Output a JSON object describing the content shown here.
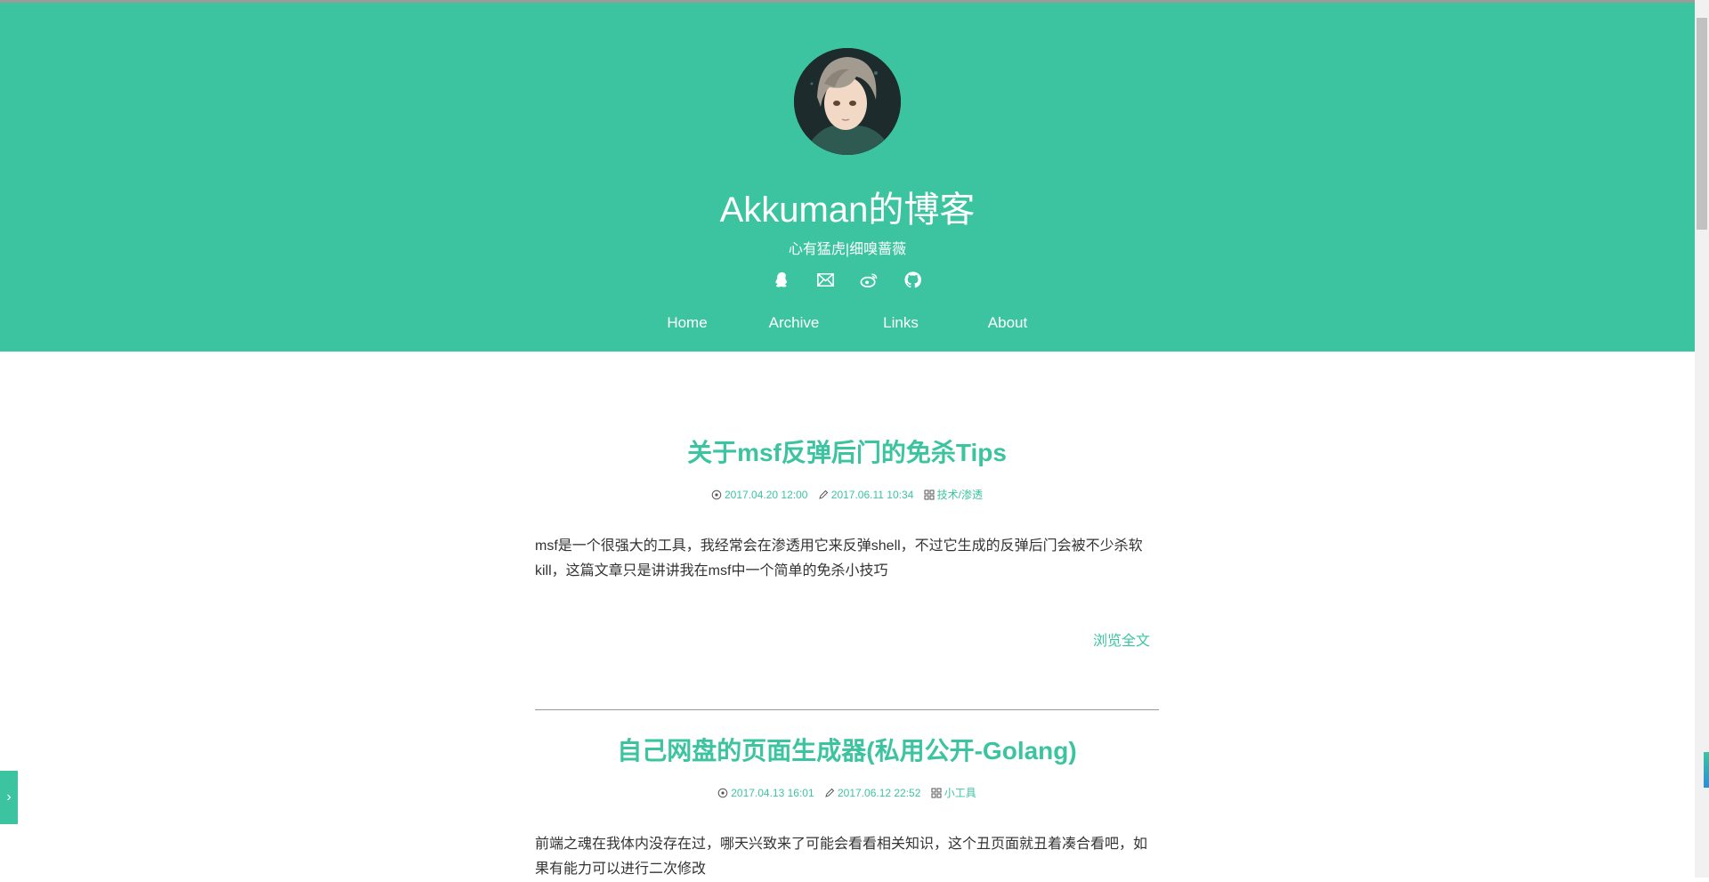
{
  "site": {
    "title": "Akkuman的博客",
    "subtitle": "心有猛虎|细嗅蔷薇",
    "accent_color": "#3cc4a0"
  },
  "social_icons": [
    "qq-icon",
    "mail-icon",
    "weibo-icon",
    "github-icon"
  ],
  "nav": {
    "home": "Home",
    "archive": "Archive",
    "links": "Links",
    "about": "About"
  },
  "posts": [
    {
      "title": "关于msf反弹后门的免杀Tips",
      "created": "2017.04.20 12:00",
      "updated": "2017.06.11 10:34",
      "category": "技术/渗透",
      "excerpt": "msf是一个很强大的工具，我经常会在渗透用它来反弹shell，不过它生成的反弹后门会被不少杀软kill，这篇文章只是讲讲我在msf中一个简单的免杀小技巧",
      "read_more": "浏览全文"
    },
    {
      "title": "自己网盘的页面生成器(私用公开-Golang)",
      "created": "2017.04.13 16:01",
      "updated": "2017.06.12 22:52",
      "category": "小工具",
      "excerpt": "前端之魂在我体内没存在过，哪天兴致来了可能会看看相关知识，这个丑页面就丑着凑合看吧，如果有能力可以进行二次修改"
    }
  ],
  "side_toggle": "›"
}
